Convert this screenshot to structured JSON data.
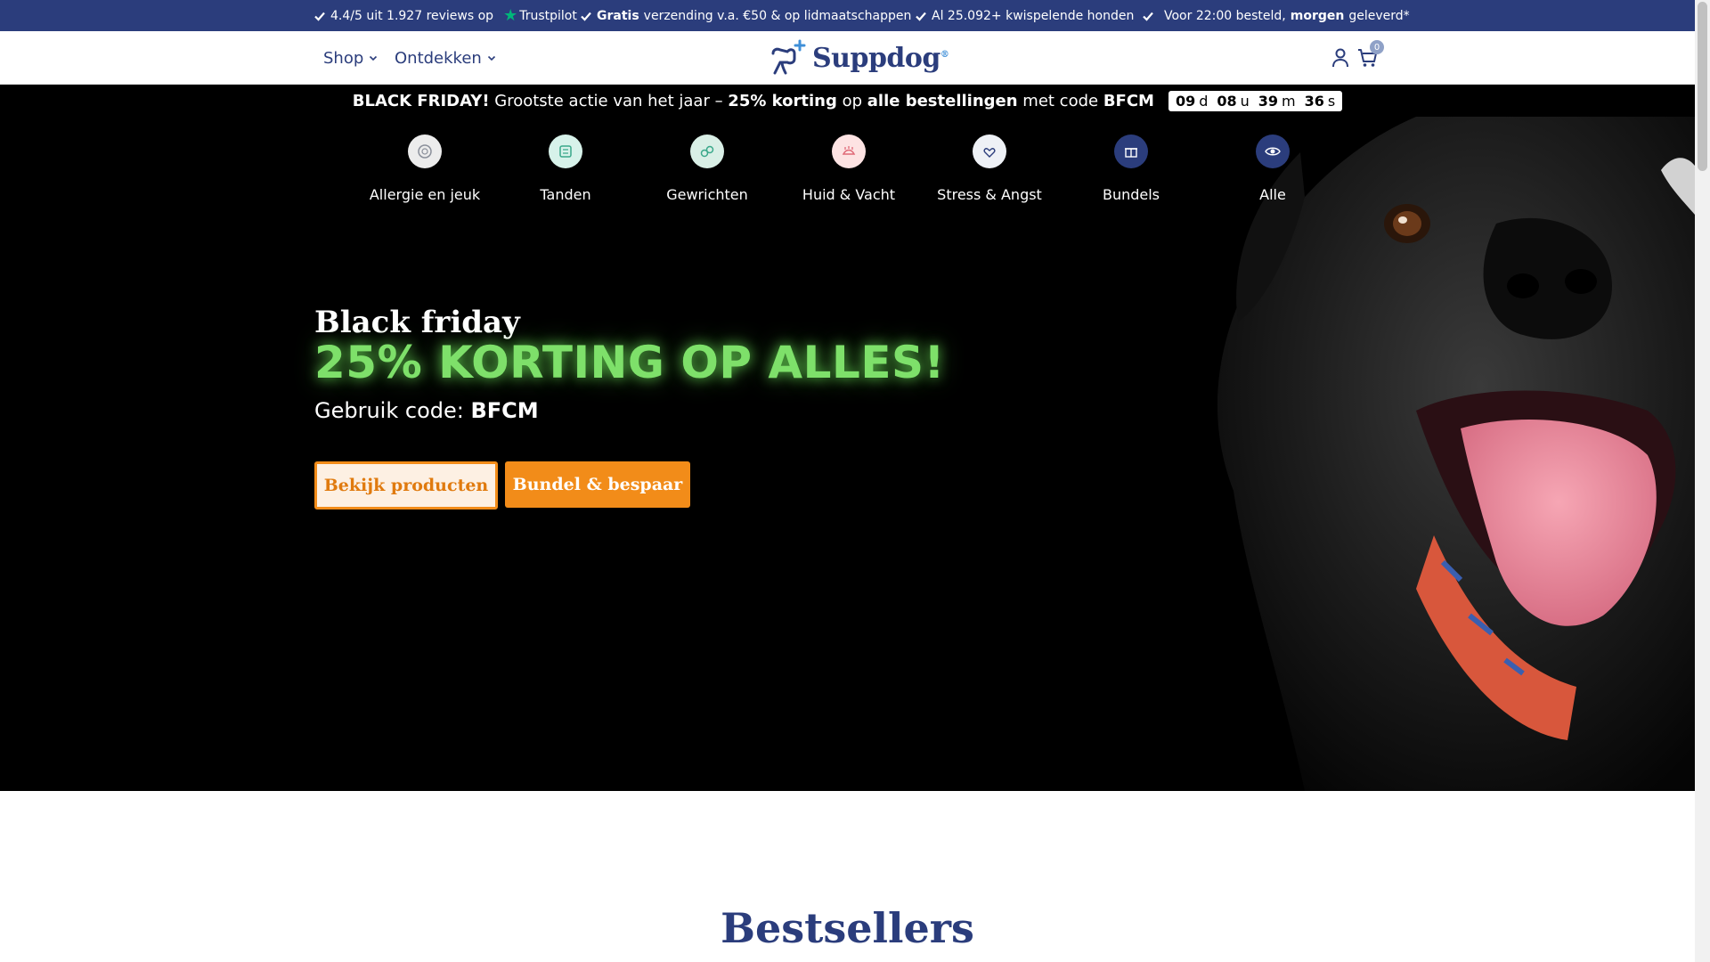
{
  "topbar": {
    "rating_text": "4.4/5 uit 1.927 reviews op",
    "trustpilot": "Trustpilot",
    "shipping_bold": "Gratis",
    "shipping_rest": "verzending v.a. €50 & op lidmaatschappen",
    "dogs": "Al 25.092+ kwispelende honden",
    "delivery_pre": "Voor 22:00 besteld,",
    "delivery_bold": "morgen",
    "delivery_post": "geleverd*"
  },
  "nav": {
    "shop": "Shop",
    "discover": "Ontdekken",
    "logo": "Suppdog",
    "logo_reg": "®",
    "cart_count": "0"
  },
  "promo": {
    "bold1": "BLACK FRIDAY!",
    "text1": " Grootste actie van het jaar – ",
    "bold2": "25% korting",
    "text2": " op ",
    "bold3": "alle bestellingen",
    "text3": " met code ",
    "bold4": "BFCM",
    "countdown": {
      "days": "09",
      "days_unit": "d",
      "hours": "08",
      "hours_unit": "u",
      "minutes": "39",
      "minutes_unit": "m",
      "seconds": "36",
      "seconds_unit": "s"
    }
  },
  "categories": [
    {
      "label": "Allergie en jeuk",
      "icon": "allergy-icon"
    },
    {
      "label": "Tanden",
      "icon": "teeth-icon"
    },
    {
      "label": "Gewrichten",
      "icon": "joints-icon"
    },
    {
      "label": "Huid & Vacht",
      "icon": "skin-coat-icon"
    },
    {
      "label": "Stress & Angst",
      "icon": "stress-icon"
    },
    {
      "label": "Bundels",
      "icon": "bundle-icon"
    },
    {
      "label": "Alle",
      "icon": "eye-icon"
    }
  ],
  "hero": {
    "title": "Black friday",
    "big": "25% KORTING OP ALLES!",
    "code_label": "Gebruik code: ",
    "code": "BFCM",
    "btn_products": "Bekijk producten",
    "btn_bundle": "Bundel & bespaar"
  },
  "sections": {
    "bestsellers": "Bestsellers"
  },
  "colors": {
    "brand_blue": "#2b3d7c",
    "accent_orange": "#f28c19",
    "promo_green": "#7ee06a"
  }
}
